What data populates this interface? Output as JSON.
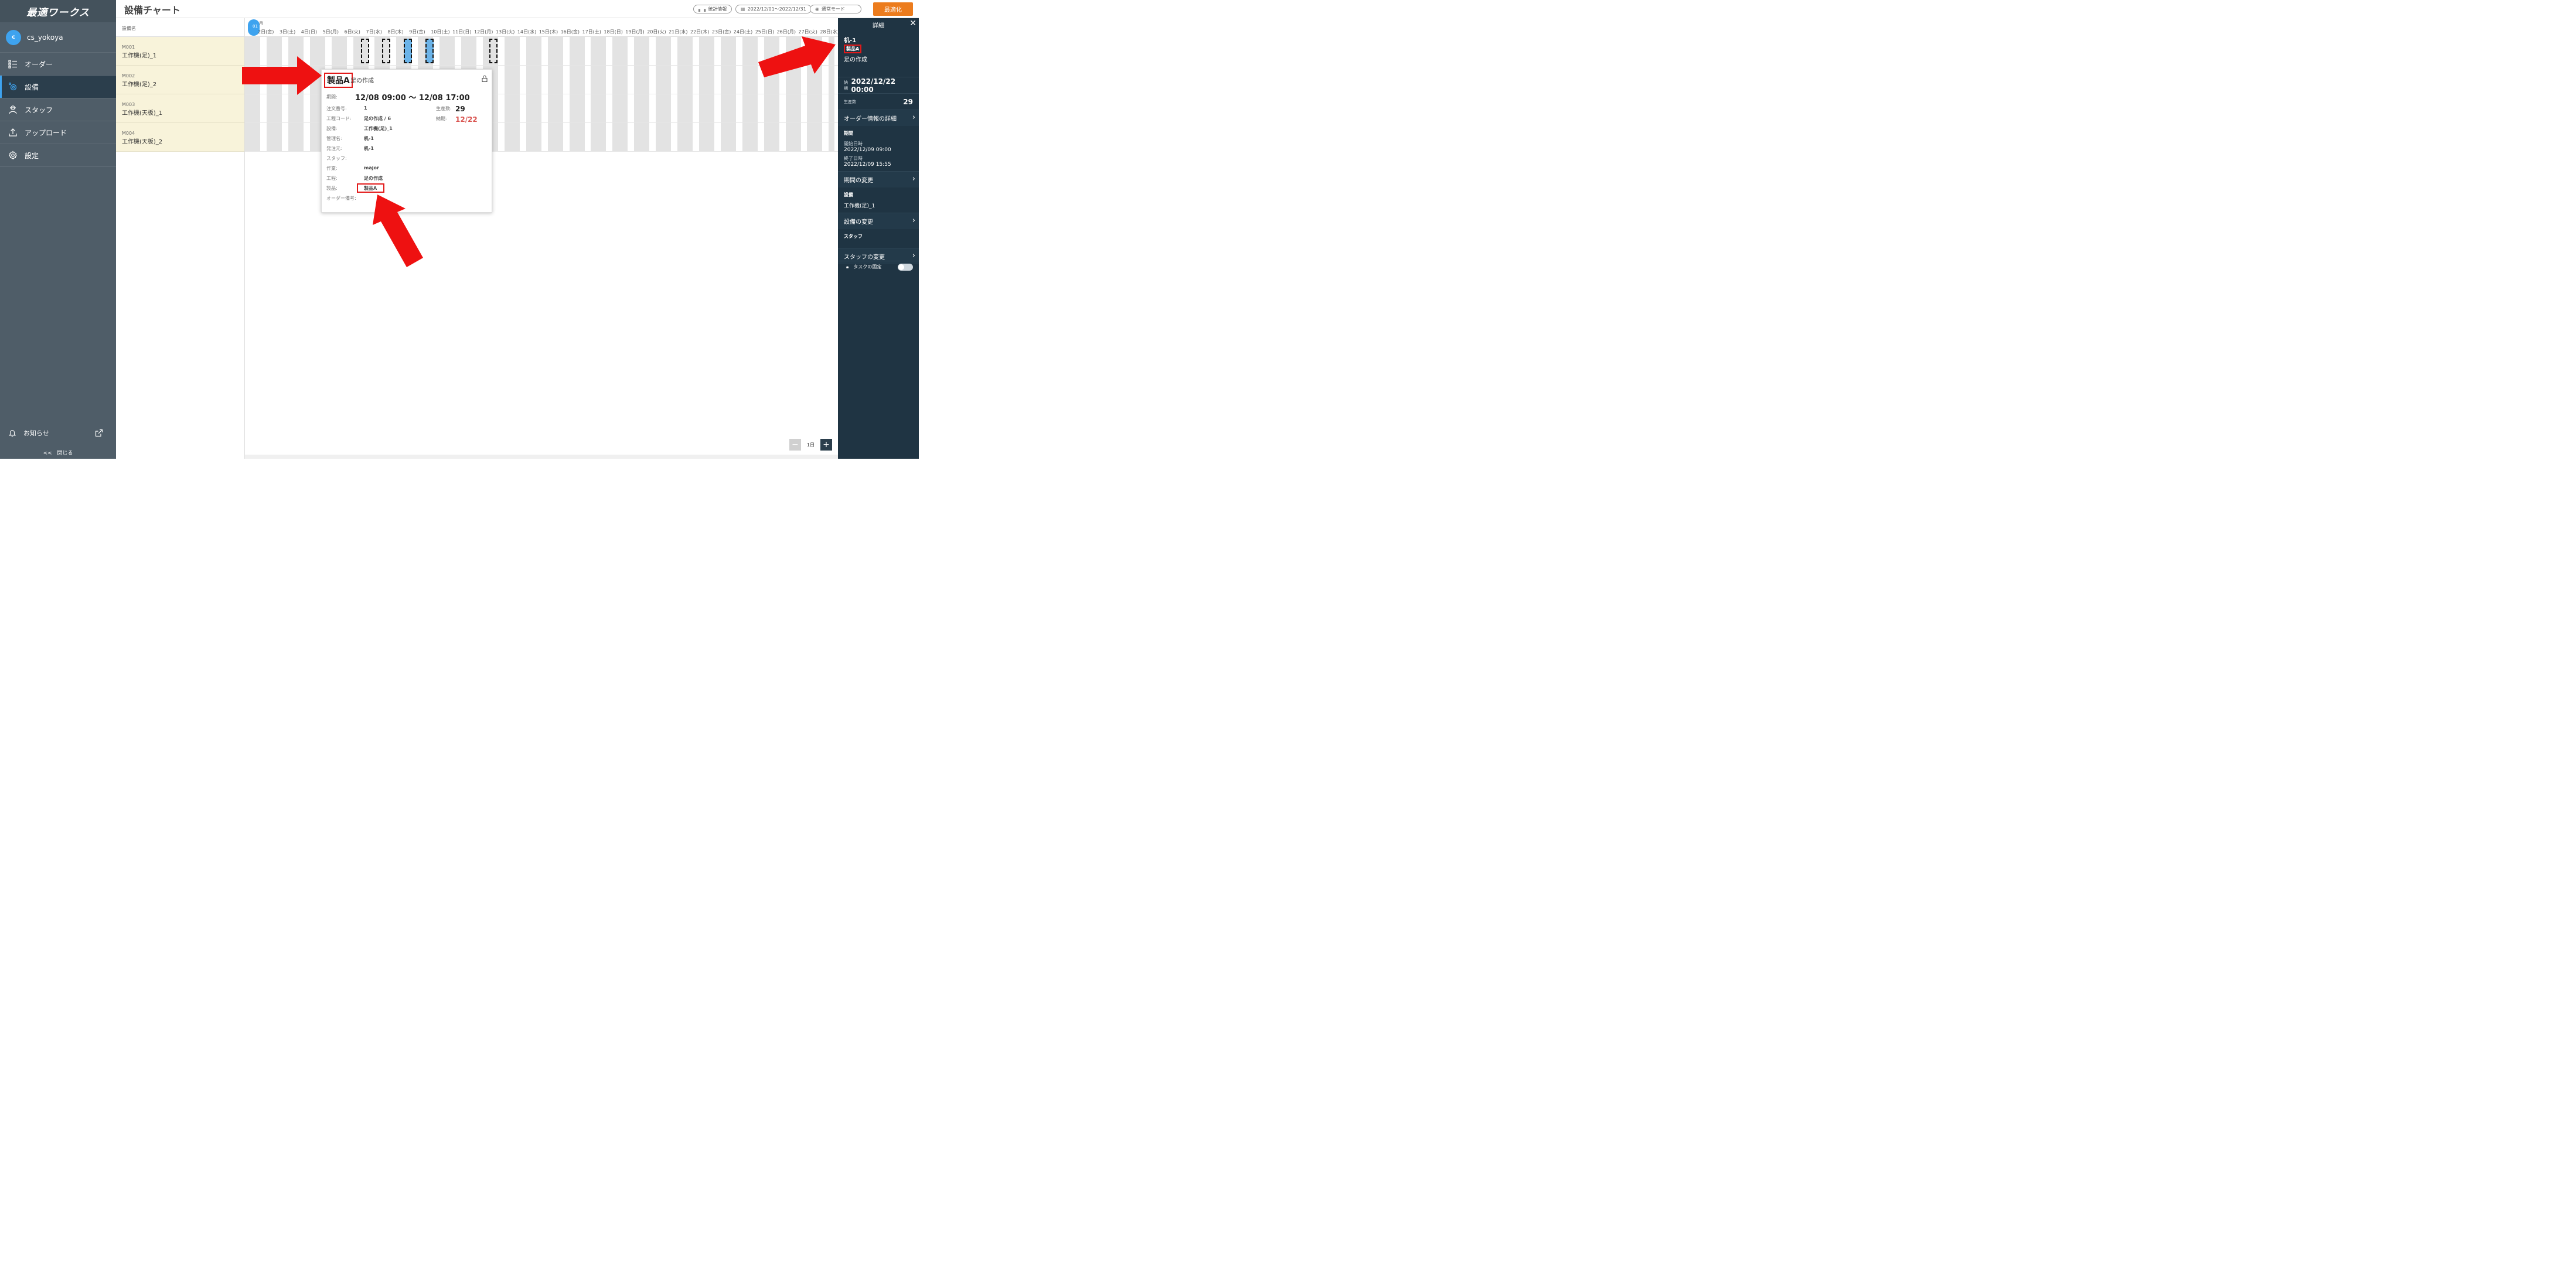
{
  "sidebar": {
    "logo": "最適ワークス",
    "user": {
      "initial": "c",
      "name": "cs_yokoya"
    },
    "items": [
      {
        "label": "オーダー",
        "icon": "list-icon"
      },
      {
        "label": "設備",
        "icon": "equipment-gear-icon",
        "active": true
      },
      {
        "label": "スタッフ",
        "icon": "staff-icon"
      },
      {
        "label": "アップロード",
        "icon": "upload-icon"
      },
      {
        "label": "設定",
        "icon": "gear-icon"
      }
    ],
    "notice": "お知らせ",
    "collapse": "閉じる",
    "collapse_glyph": "<<"
  },
  "header": {
    "title": "設備チャート",
    "stats_label": "統計情報",
    "date_range": "2022/12/01〜2022/12/31",
    "mode": "通常モード",
    "optimize": "最適化"
  },
  "equipment": {
    "header": "設備名",
    "rows": [
      {
        "code": "M001",
        "name": "工作機(足)_1"
      },
      {
        "code": "M002",
        "name": "工作機(足)_2"
      },
      {
        "code": "M003",
        "name": "工作機(天板)_1"
      },
      {
        "code": "M004",
        "name": "工作機(天板)_2"
      }
    ]
  },
  "chart": {
    "month": "月",
    "today": "01",
    "days": [
      "2日(金)",
      "3日(土)",
      "4日(日)",
      "5日(月)",
      "6日(火)",
      "7日(水)",
      "8日(木)",
      "9日(金)",
      "10日(土)",
      "11日(日)",
      "12日(月)",
      "13日(火)",
      "14日(水)",
      "15日(木)",
      "16日(金)",
      "17日(土)",
      "18日(日)",
      "19日(月)",
      "20日(火)",
      "21日(水)",
      "22日(木)",
      "23日(金)",
      "24日(土)",
      "25日(日)",
      "26日(月)",
      "27日(火)",
      "28日(水)"
    ],
    "zoom_level": "1日"
  },
  "popup": {
    "product": "製品A",
    "process": "足の作成",
    "period_label": "期間:",
    "period": "12/08 09:00 〜 12/08 17:00",
    "order_no_label": "注文番号:",
    "order_no": "1",
    "qty_label": "生産数:",
    "qty": "29",
    "process_code_label": "工程コード:",
    "process_code": "足の作成 / 6",
    "due_label": "納期:",
    "due": "12/22",
    "equipment_label": "設備:",
    "equipment": "工作機(足)_1",
    "manager_label": "管理名:",
    "manager": "机-1",
    "orderer_label": "発注元:",
    "orderer": "机-1",
    "staff_label": "スタッフ:",
    "work_label": "作業:",
    "work": "major",
    "step_label": "工程:",
    "step": "足の作成",
    "product_label": "製品:",
    "product_value": "製品A",
    "note_label": "オーダー備考:"
  },
  "detail": {
    "title": "詳細",
    "equipment_code": "机-1",
    "product": "製品A",
    "process": "足の作成",
    "due_label": "納期",
    "due": "2022/12/22 00:00",
    "qty_label": "生産数",
    "qty": "29",
    "order_detail": "オーダー情報の詳細",
    "period_heading": "期間",
    "start_label": "開始日時",
    "start": "2022/12/09 09:00",
    "end_label": "終了日時",
    "end": "2022/12/09 15:55",
    "change_period": "期間の変更",
    "equipment_heading": "設備",
    "equipment_name": "工作機(足)_1",
    "change_equipment": "設備の変更",
    "staff_heading": "スタッフ",
    "change_staff": "スタッフの変更",
    "task_lock": "タスクの固定"
  },
  "colors": {
    "sidebar": "#4f5d68",
    "sidebar_active": "#2b3e4c",
    "accent": "#3ea3ef",
    "optimize": "#ec7c1d",
    "detail_panel": "#1f3443",
    "annotation": "#e21a1a",
    "due_text": "#d9534f"
  }
}
